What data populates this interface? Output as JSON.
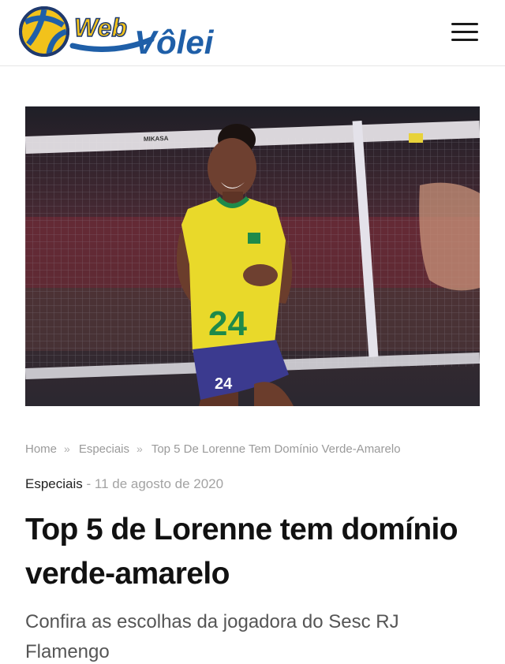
{
  "header": {
    "logo_text_web": "Web",
    "logo_text_volei": "Vôlei",
    "menu_icon": "hamburger-menu-icon"
  },
  "hero": {
    "jersey_number": "24",
    "shorts_number": "24",
    "net_brand": "MIKASA"
  },
  "breadcrumb": {
    "items": [
      "Home",
      "Especiais",
      "Top 5 De Lorenne Tem Domínio Verde-Amarelo"
    ],
    "separator": "»"
  },
  "meta": {
    "category": "Especiais",
    "separator": " - ",
    "date": "11 de agosto de 2020"
  },
  "article": {
    "title": "Top 5 de Lorenne tem domínio verde-amarelo",
    "subtitle": "Confira as escolhas da jogadora do Sesc RJ Flamengo"
  },
  "colors": {
    "brand_blue": "#1f5fa8",
    "brand_yellow": "#f2c21b",
    "jersey_yellow": "#e9d92a",
    "jersey_green": "#1e8a4a",
    "shorts_blue": "#3b3a8f"
  }
}
